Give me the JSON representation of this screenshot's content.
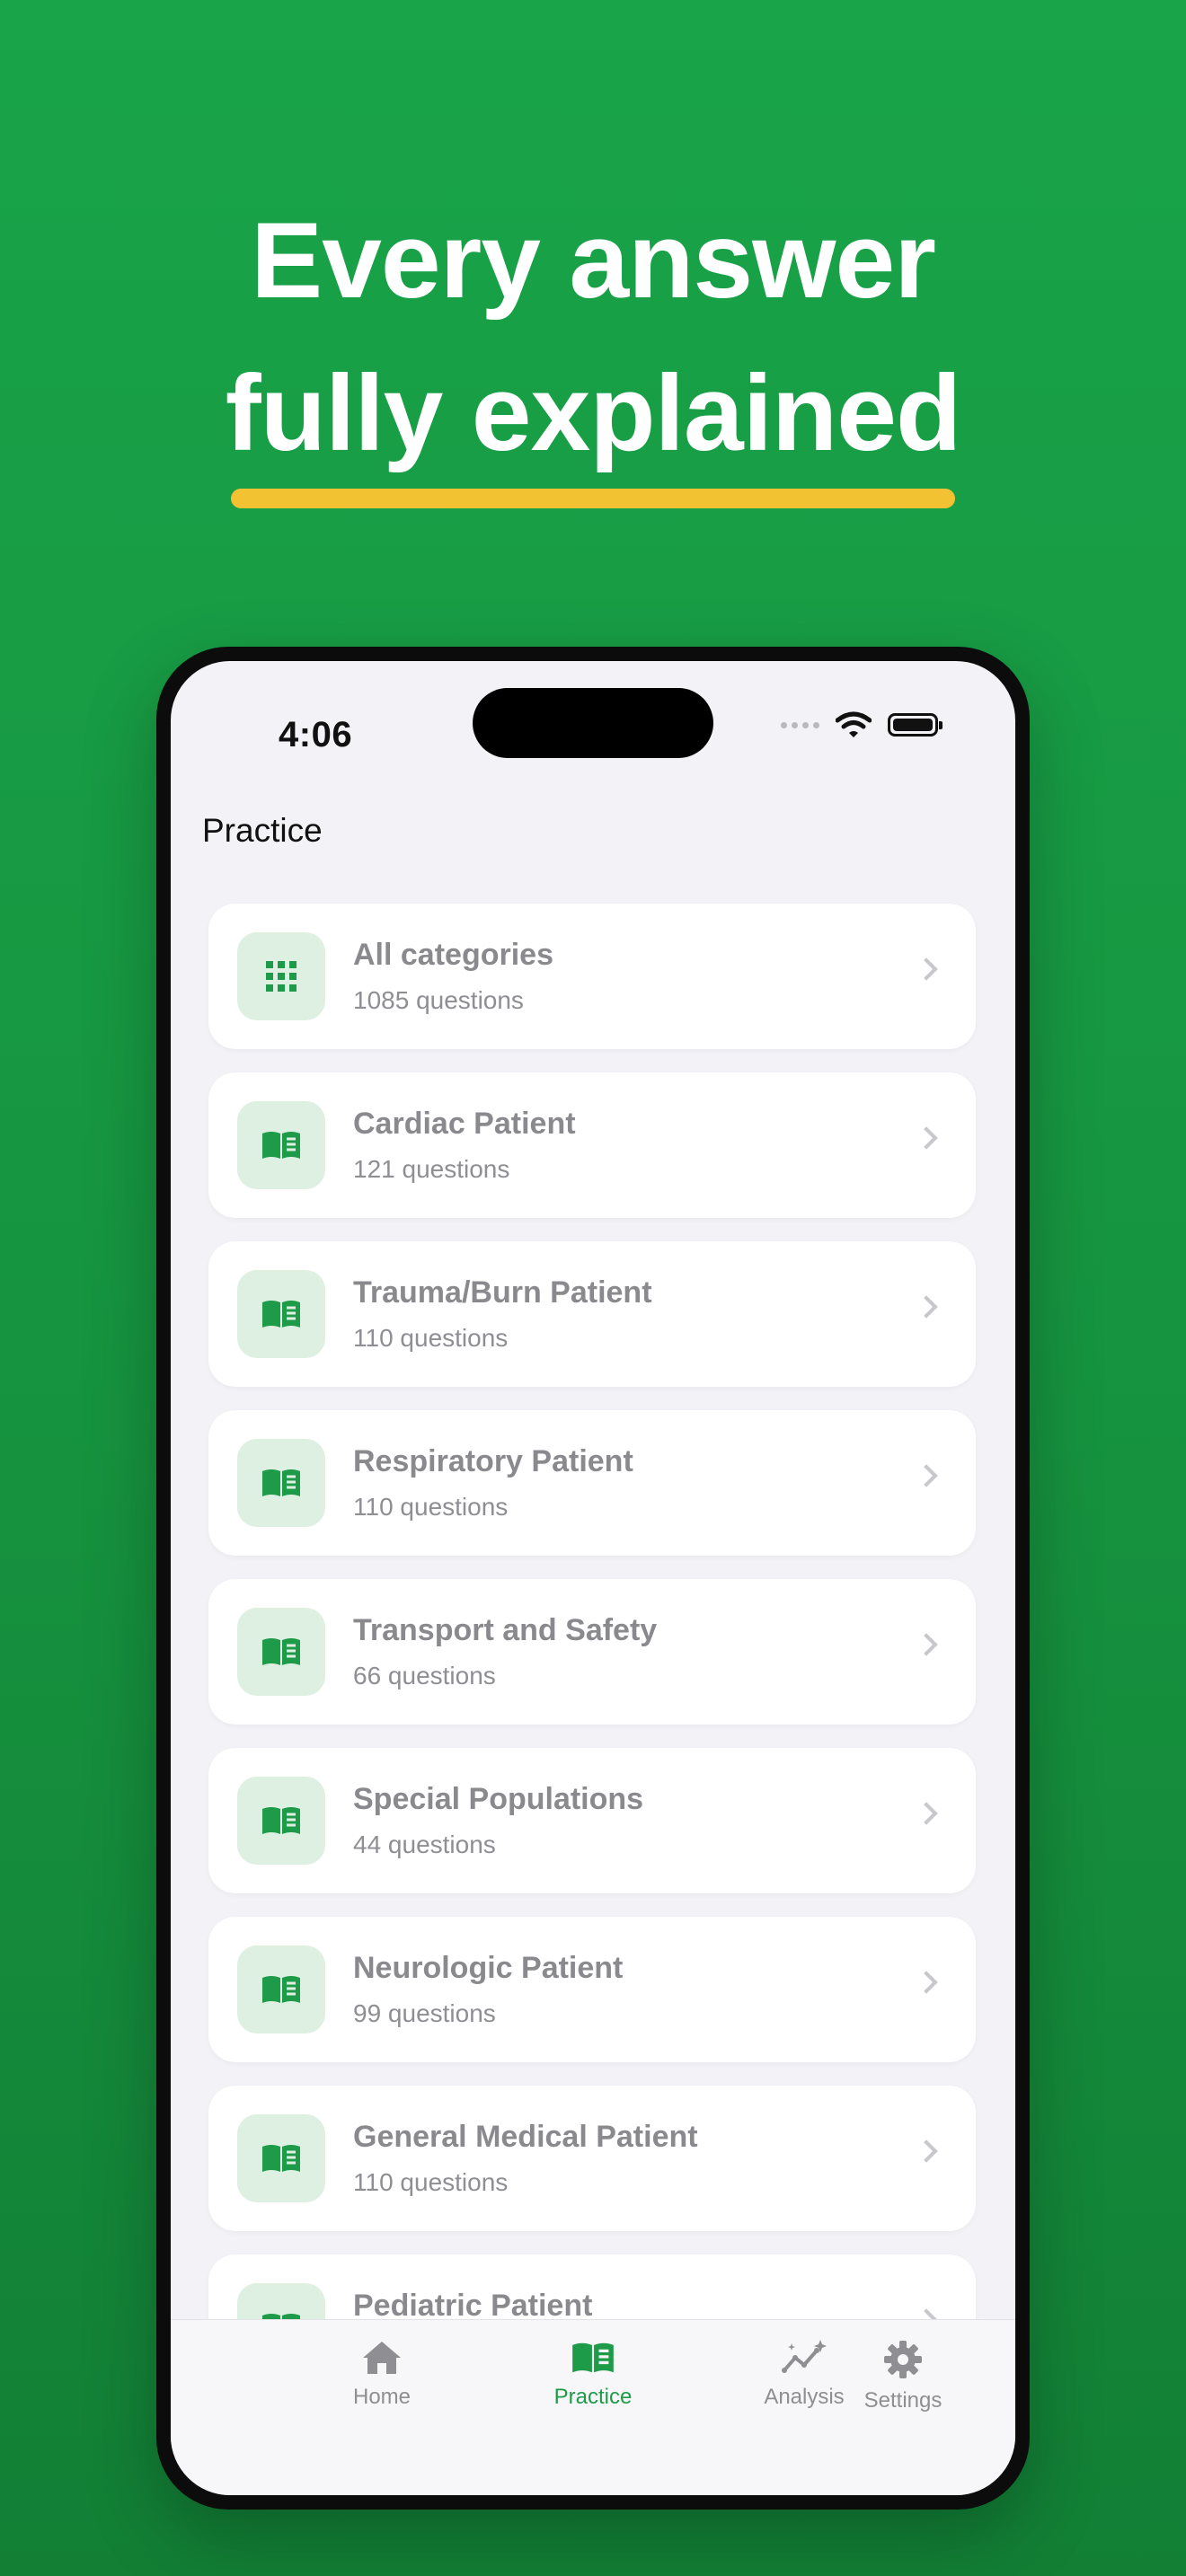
{
  "headline": {
    "line1": "Every answer",
    "line2": "fully explained"
  },
  "colors": {
    "accent": "#1e9b48",
    "highlight": "#f2c232",
    "background": "#19a449"
  },
  "status_bar": {
    "time": "4:06"
  },
  "nav": {
    "title": "Practice"
  },
  "categories": [
    {
      "title": "All categories",
      "subtitle": "1085 questions",
      "icon": "grid-icon"
    },
    {
      "title": "Cardiac Patient",
      "subtitle": "121 questions",
      "icon": "book-icon"
    },
    {
      "title": "Trauma/Burn Patient",
      "subtitle": "110 questions",
      "icon": "book-icon"
    },
    {
      "title": "Respiratory Patient",
      "subtitle": "110 questions",
      "icon": "book-icon"
    },
    {
      "title": "Transport and Safety",
      "subtitle": "66 questions",
      "icon": "book-icon"
    },
    {
      "title": "Special Populations",
      "subtitle": "44 questions",
      "icon": "book-icon"
    },
    {
      "title": "Neurologic Patient",
      "subtitle": "99 questions",
      "icon": "book-icon"
    },
    {
      "title": "General Medical Patient",
      "subtitle": "110 questions",
      "icon": "book-icon"
    },
    {
      "title": "Pediatric Patient",
      "subtitle": "",
      "icon": "book-icon"
    }
  ],
  "tabs": [
    {
      "label": "Home",
      "icon": "house-icon",
      "active": false
    },
    {
      "label": "Practice",
      "icon": "book-icon",
      "active": true
    },
    {
      "label": "Analysis",
      "icon": "chart-sparkle-icon",
      "active": false
    },
    {
      "label": "Settings",
      "icon": "gear-icon",
      "active": false
    }
  ]
}
